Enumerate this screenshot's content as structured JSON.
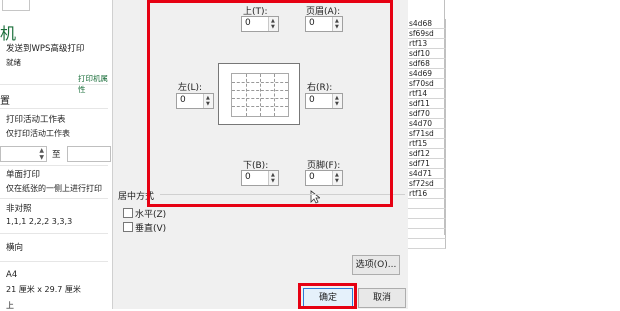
{
  "print_panel": {
    "title_fragment": "机",
    "printer_name": "发送到WPS高级打印",
    "printer_status": "就绪",
    "printer_properties_link": "打印机属性",
    "settings_heading": "置",
    "print_scope": {
      "line1": "打印活动工作表",
      "line2": "仅打印活动工作表"
    },
    "pages_to": "至",
    "duplex": {
      "line1": "单面打印",
      "line2": "仅在纸张的一侧上进行打印"
    },
    "collate": {
      "line1": "非对照",
      "line2": "1,1,1    2,2,2    3,3,3"
    },
    "orientation": "横向",
    "paper": {
      "line1": "A4",
      "line2": "21 厘米 x 29.7 厘米"
    },
    "bottom_fragment": "上"
  },
  "margins_dialog": {
    "top": {
      "label": "上(T):",
      "value": "0"
    },
    "header": {
      "label": "页眉(A):",
      "value": "0"
    },
    "left": {
      "label": "左(L):",
      "value": "0"
    },
    "right": {
      "label": "右(R):",
      "value": "0"
    },
    "bottom": {
      "label": "下(B):",
      "value": "0"
    },
    "footer": {
      "label": "页脚(F):",
      "value": "0"
    },
    "center_on_page": "居中方式",
    "horizontally": "水平(Z)",
    "vertically": "垂直(V)",
    "options_button": "选项(O)...",
    "ok_button": "确定",
    "cancel_button": "取消"
  },
  "sheet_cells": [
    "s4d68",
    "sf69sd",
    "rtf13",
    "sdf10",
    "sdf68",
    "s4d69",
    "sf70sd",
    "rtf14",
    "sdf11",
    "sdf70",
    "s4d70",
    "sf71sd",
    "rtf15",
    "sdf12",
    "sdf71",
    "s4d71",
    "sf72sd",
    "rtf16"
  ],
  "colors": {
    "highlight": "#e60012",
    "link_green": "#1a6e3a"
  }
}
